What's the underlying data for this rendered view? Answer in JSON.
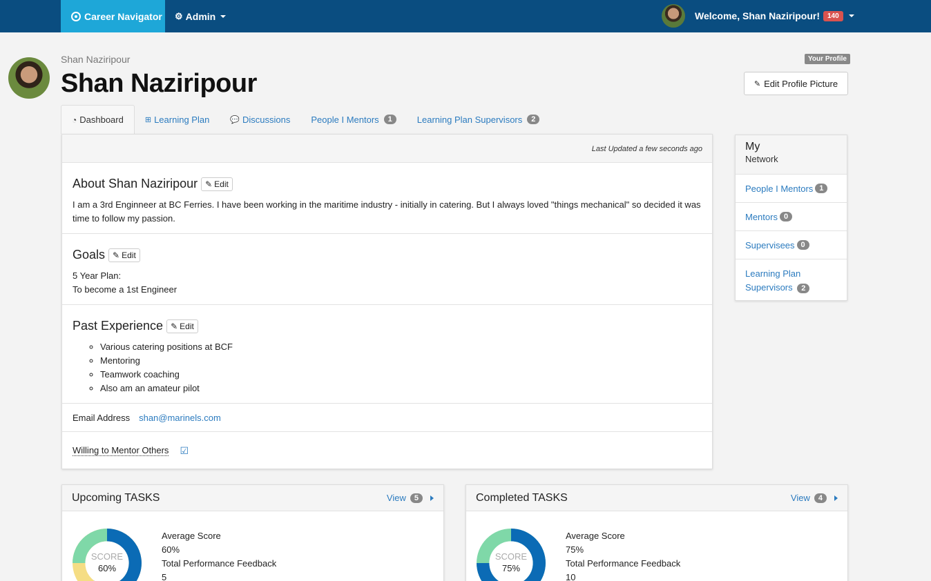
{
  "nav": {
    "brand": "Career Navigator",
    "admin": "Admin",
    "welcome": "Welcome, Shan Naziripour!",
    "notifications": "140"
  },
  "profile": {
    "subname": "Shan Naziripour",
    "name": "Shan Naziripour",
    "your_profile": "Your Profile",
    "edit_picture": "Edit Profile Picture"
  },
  "tabs": [
    {
      "label": "Dashboard"
    },
    {
      "label": "Learning Plan"
    },
    {
      "label": "Discussions"
    },
    {
      "label": "People I Mentors",
      "count": "1"
    },
    {
      "label": "Learning Plan Supervisors",
      "count": "2"
    }
  ],
  "main": {
    "last_updated": "Last Updated a few seconds ago",
    "edit_label": "Edit",
    "about_title": "About Shan Naziripour",
    "about_text": "I am a 3rd Enginneer at BC Ferries. I have been working in the maritime industry - initially in catering. But I always loved \"things mechanical\" so decided it was time to follow my passion.",
    "goals_title": "Goals",
    "goals_line1": "5 Year Plan:",
    "goals_line2": "To become a 1st Engineer",
    "exp_title": "Past Experience",
    "experience": [
      "Various catering positions at BCF",
      "Mentoring",
      "Teamwork coaching",
      "Also am an amateur pilot"
    ],
    "email_label": "Email Address",
    "email": "shan@marinels.com",
    "mentor_label": "Willing to Mentor Others",
    "mentor_checked": true
  },
  "network": {
    "title": "My",
    "subtitle": "Network",
    "items": [
      {
        "label": "People I Mentors",
        "count": "1"
      },
      {
        "label": "Mentors",
        "count": "0"
      },
      {
        "label": "Supervisees",
        "count": "0"
      },
      {
        "label": "Learning Plan Supervisors",
        "line1": "Learning Plan",
        "line2": "Supervisors",
        "count": "2"
      }
    ]
  },
  "cards": [
    {
      "title": "Upcoming TASKS",
      "view_label": "View",
      "view_count": "5",
      "score_label": "SCORE",
      "score": "60%",
      "score_value": 60,
      "avg_label": "Average Score",
      "avg_value": "60%",
      "feedback_label": "Total Performance Feedback",
      "feedback_value": "5"
    },
    {
      "title": "Completed TASKS",
      "view_label": "View",
      "view_count": "4",
      "score_label": "SCORE",
      "score": "75%",
      "score_value": 75,
      "avg_label": "Average Score",
      "avg_value": "75%",
      "feedback_label": "Total Performance Feedback",
      "feedback_value": "10"
    }
  ],
  "colors": {
    "navbar": "#0a4d80",
    "brand": "#1ea7d8",
    "link": "#2b7bbf",
    "donut_main": "#0b6bb5",
    "donut_green": "#7fd8a8",
    "donut_yellow": "#f5dd84"
  }
}
